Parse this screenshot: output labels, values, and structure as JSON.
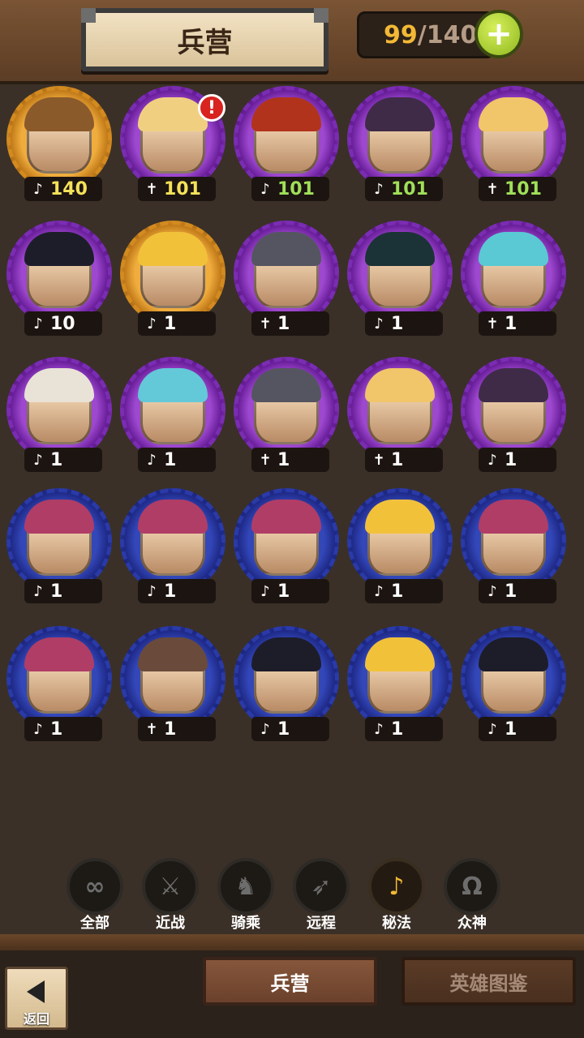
{
  "header": {
    "title": "兵营",
    "counter_current": "99",
    "counter_separator": "/",
    "counter_max": "140",
    "add_label": "+"
  },
  "heroes": [
    {
      "ring": "gold",
      "hair": "#8b5a2b",
      "class_icon": "magic",
      "count": "140",
      "count_color": "yellow",
      "alert": false
    },
    {
      "ring": "purple",
      "hair": "#f0d080",
      "class_icon": "melee",
      "count": "101",
      "count_color": "yellow",
      "alert": true
    },
    {
      "ring": "purple",
      "hair": "#b2331c",
      "class_icon": "magic",
      "count": "101",
      "count_color": "green",
      "alert": false
    },
    {
      "ring": "purple",
      "hair": "#3f2b48",
      "class_icon": "magic",
      "count": "101",
      "count_color": "green",
      "alert": false
    },
    {
      "ring": "purple",
      "hair": "#f1c56a",
      "class_icon": "melee",
      "count": "101",
      "count_color": "green",
      "alert": false
    },
    {
      "ring": "purple",
      "hair": "#1d1d2a",
      "class_icon": "magic",
      "count": "10",
      "count_color": "white",
      "alert": false
    },
    {
      "ring": "gold",
      "hair": "#f2c13a",
      "class_icon": "magic",
      "count": "1",
      "count_color": "white",
      "alert": false
    },
    {
      "ring": "purple",
      "hair": "#555561",
      "class_icon": "melee",
      "count": "1",
      "count_color": "white",
      "alert": false
    },
    {
      "ring": "purple",
      "hair": "#1b3336",
      "class_icon": "magic",
      "count": "1",
      "count_color": "white",
      "alert": false
    },
    {
      "ring": "purple",
      "hair": "#5ac9d4",
      "class_icon": "melee",
      "count": "1",
      "count_color": "white",
      "alert": false
    },
    {
      "ring": "purple",
      "hair": "#e9e2d6",
      "class_icon": "magic",
      "count": "1",
      "count_color": "white",
      "alert": false
    },
    {
      "ring": "purple",
      "hair": "#63c9d8",
      "class_icon": "magic",
      "count": "1",
      "count_color": "white",
      "alert": false
    },
    {
      "ring": "purple",
      "hair": "#555561",
      "class_icon": "melee",
      "count": "1",
      "count_color": "white",
      "alert": false
    },
    {
      "ring": "purple",
      "hair": "#f1c56a",
      "class_icon": "melee",
      "count": "1",
      "count_color": "white",
      "alert": false
    },
    {
      "ring": "purple",
      "hair": "#3f2b48",
      "class_icon": "magic",
      "count": "1",
      "count_color": "white",
      "alert": false
    },
    {
      "ring": "blue",
      "hair": "#b03d66",
      "class_icon": "magic",
      "count": "1",
      "count_color": "white",
      "alert": false
    },
    {
      "ring": "blue",
      "hair": "#b03d66",
      "class_icon": "magic",
      "count": "1",
      "count_color": "white",
      "alert": false
    },
    {
      "ring": "blue",
      "hair": "#b03d66",
      "class_icon": "magic",
      "count": "1",
      "count_color": "white",
      "alert": false
    },
    {
      "ring": "blue",
      "hair": "#f2c13a",
      "class_icon": "magic",
      "count": "1",
      "count_color": "white",
      "alert": false
    },
    {
      "ring": "blue",
      "hair": "#b03d66",
      "class_icon": "magic",
      "count": "1",
      "count_color": "white",
      "alert": false
    },
    {
      "ring": "blue",
      "hair": "#b03d66",
      "class_icon": "magic",
      "count": "1",
      "count_color": "white",
      "alert": false
    },
    {
      "ring": "blue",
      "hair": "#6a4a3a",
      "class_icon": "melee",
      "count": "1",
      "count_color": "white",
      "alert": false
    },
    {
      "ring": "blue",
      "hair": "#1d1d2a",
      "class_icon": "magic",
      "count": "1",
      "count_color": "white",
      "alert": false
    },
    {
      "ring": "blue",
      "hair": "#f2c13a",
      "class_icon": "magic",
      "count": "1",
      "count_color": "white",
      "alert": false
    },
    {
      "ring": "blue",
      "hair": "#1d1d2a",
      "class_icon": "magic",
      "count": "1",
      "count_color": "white",
      "alert": false
    }
  ],
  "alert_symbol": "!",
  "class_icons": {
    "magic": "♪",
    "melee": "✝"
  },
  "filters": [
    {
      "symbol": "∞",
      "label": "全部",
      "active": false
    },
    {
      "symbol": "⚔",
      "label": "近战",
      "active": false
    },
    {
      "symbol": "♞",
      "label": "骑乘",
      "active": false
    },
    {
      "symbol": "➶",
      "label": "远程",
      "active": false
    },
    {
      "symbol": "♪",
      "label": "秘法",
      "active": true
    },
    {
      "symbol": "Ω",
      "label": "众神",
      "active": false
    }
  ],
  "bottom": {
    "back_label": "返回",
    "tab_barracks": "兵营",
    "tab_codex": "英雄图鉴"
  }
}
